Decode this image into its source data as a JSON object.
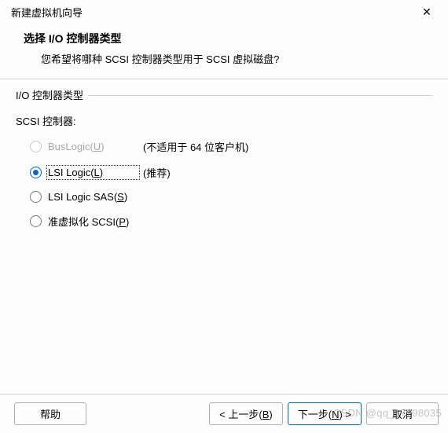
{
  "window": {
    "title": "新建虚拟机向导",
    "close": "✕"
  },
  "header": {
    "title": "选择 I/O 控制器类型",
    "subtitle": "您希望将哪种 SCSI 控制器类型用于 SCSI 虚拟磁盘?"
  },
  "group": {
    "legend": "I/O 控制器类型",
    "scsi_label": "SCSI 控制器:"
  },
  "options": {
    "buslogic": {
      "label_pre": "BusLogic(",
      "hotkey": "U",
      "label_post": ")",
      "note": "(不适用于 64 位客户机)",
      "selected": false,
      "disabled": true
    },
    "lsilogic": {
      "label_pre": "LSI Logic(",
      "hotkey": "L",
      "label_post": ")",
      "note": "(推荐)",
      "selected": true,
      "disabled": false
    },
    "lsisas": {
      "label_pre": "LSI Logic SAS(",
      "hotkey": "S",
      "label_post": ")",
      "note": "",
      "selected": false,
      "disabled": false
    },
    "paravirt": {
      "label_pre": "准虚拟化 SCSI(",
      "hotkey": "P",
      "label_post": ")",
      "note": "",
      "selected": false,
      "disabled": false
    }
  },
  "buttons": {
    "help": "帮助",
    "back_pre": "< 上一步(",
    "back_hotkey": "B",
    "back_post": ")",
    "next_pre": "下一步(",
    "next_hotkey": "N",
    "next_post": ") >",
    "cancel": "取消"
  },
  "watermark": "CSDN @qq_17798035"
}
